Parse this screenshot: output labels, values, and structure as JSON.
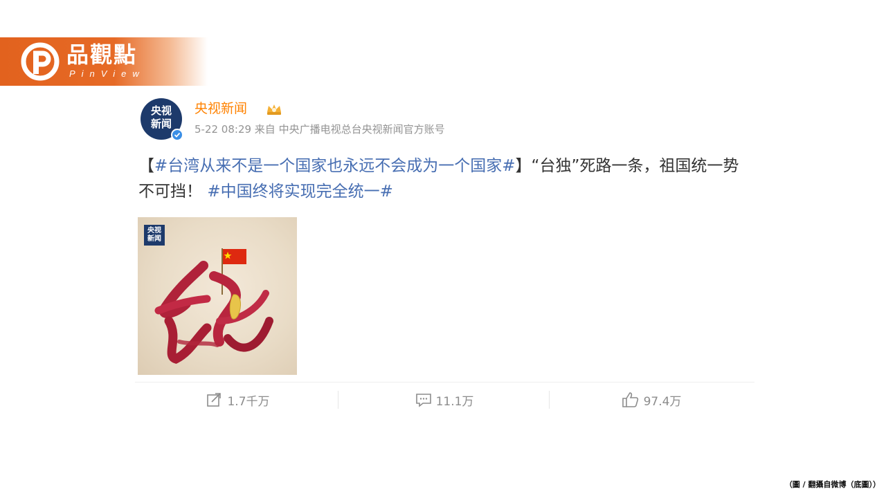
{
  "brand": {
    "name": "品觀點",
    "subtitle": "PinView"
  },
  "post": {
    "avatar_line1": "央视",
    "avatar_line2": "新闻",
    "user_name": "央视新闻",
    "meta": "5-22 08:29 来自 中央广播电视总台央视新闻官方账号",
    "content": {
      "bracket_open": "【",
      "tag1": "#台湾从来不是一个国家也永远不会成为一个国家#",
      "bracket_close": "】",
      "text": "“台独”死路一条，祖国统一势不可挡！",
      "tag2": "#中国终将实现完全统一#"
    },
    "image": {
      "logo_line1": "央视",
      "logo_line2": "新闻"
    }
  },
  "actions": {
    "repost": "1.7千万",
    "comment": "11.1万",
    "like": "97.4万"
  },
  "caption": "（圖 / 翻攝自微博（底圖））",
  "colors": {
    "brand_orange": "#e2621e",
    "user_name": "#ff8200",
    "hashtag": "#476eb2",
    "meta": "#939393"
  }
}
